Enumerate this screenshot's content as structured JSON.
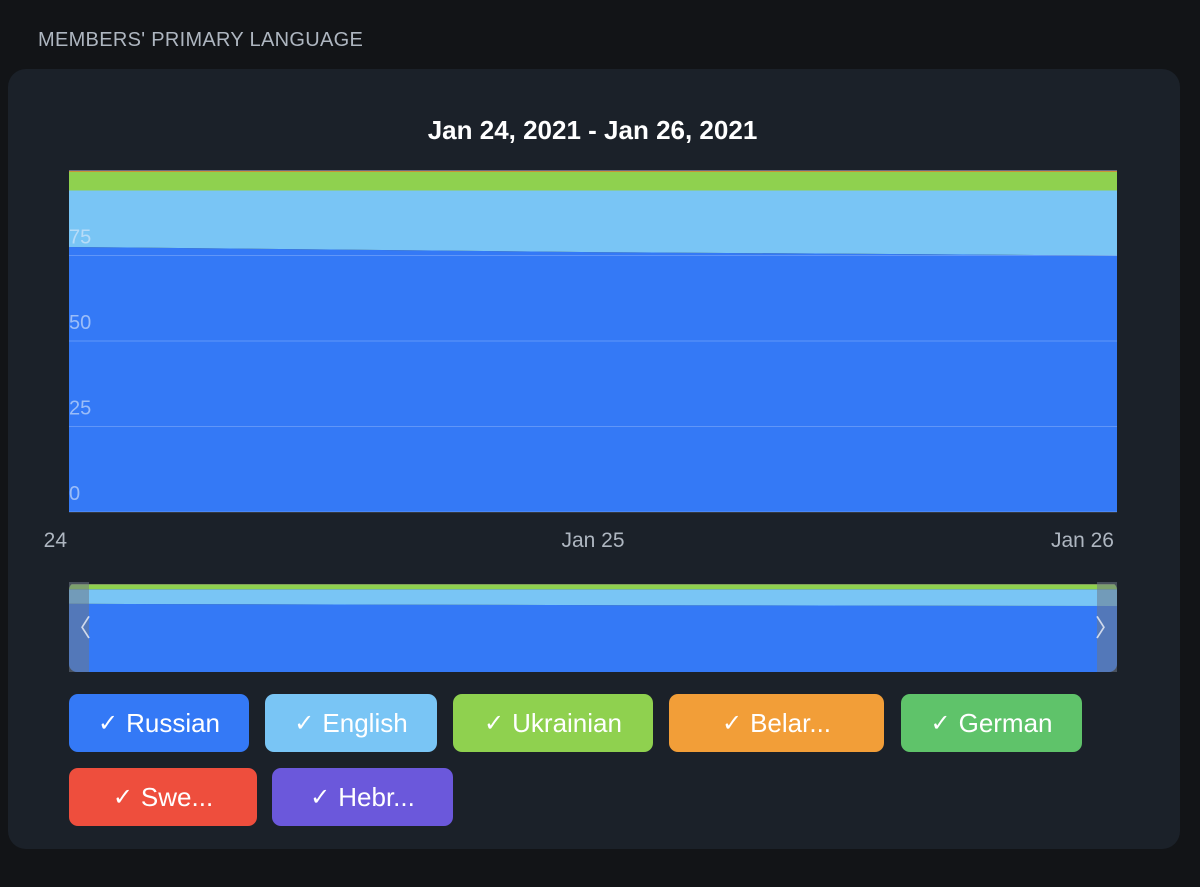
{
  "section_title": "MEMBERS' PRIMARY LANGUAGE",
  "chart_data": {
    "type": "area",
    "stacked": true,
    "title": "Jan 24, 2021 - Jan 26, 2021",
    "x": [
      "Jan 24",
      "Jan 25",
      "Jan 26"
    ],
    "x_tick_labels": [
      "24",
      "Jan 25",
      "Jan 26"
    ],
    "y_ticks": [
      "0",
      "25",
      "50",
      "75"
    ],
    "ylim": [
      0,
      100
    ],
    "grid": true,
    "series": [
      {
        "name": "Russian",
        "color": "#3479f6",
        "values": [
          77.5,
          76.0,
          75.0
        ]
      },
      {
        "name": "English",
        "color": "#79c5f5",
        "values": [
          16.5,
          18.0,
          19.0
        ]
      },
      {
        "name": "Ukrainian",
        "color": "#8fd14f",
        "values": [
          5.5,
          5.5,
          5.5
        ]
      },
      {
        "name": "Belar...",
        "color": "#f29e38",
        "values": [
          0.2,
          0.2,
          0.2
        ]
      },
      {
        "name": "German",
        "color": "#5fc36a",
        "values": [
          0.1,
          0.1,
          0.1
        ]
      },
      {
        "name": "Swe...",
        "color": "#ee4e3d",
        "values": [
          0.1,
          0.1,
          0.1
        ]
      },
      {
        "name": "Hebr...",
        "color": "#6b58db",
        "values": [
          0.1,
          0.1,
          0.1
        ]
      }
    ],
    "legend_check": "✓"
  }
}
